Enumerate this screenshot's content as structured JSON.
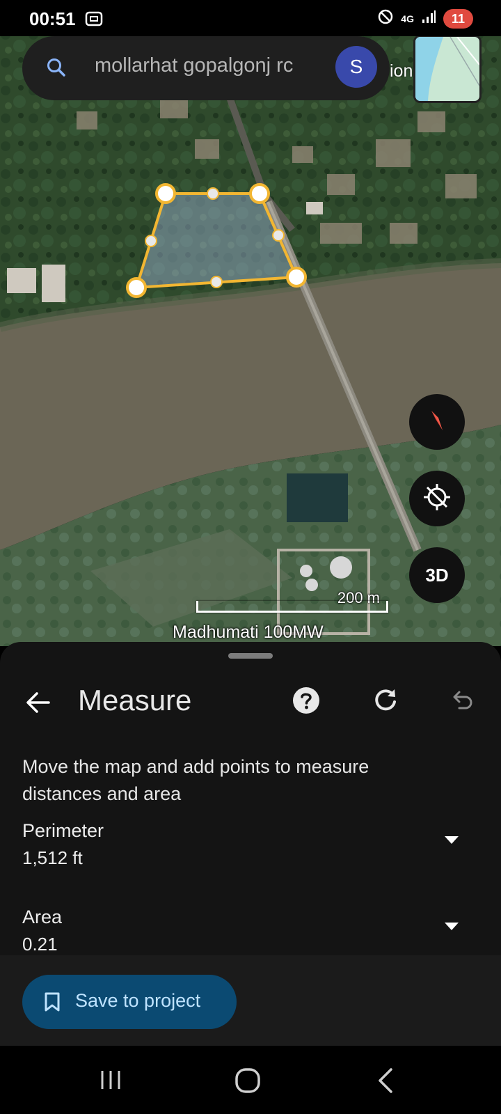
{
  "status_bar": {
    "time": "00:51",
    "network": "4G",
    "battery": "11"
  },
  "search": {
    "placeholder": "mollarhat gopalgonj rc",
    "avatar_letter": "S"
  },
  "map": {
    "scale_label": "200 m",
    "place_label": "Madhumati 100MW",
    "partial_label": "ion",
    "button_3d": "3D"
  },
  "measure_sheet": {
    "title": "Measure",
    "instructions": "Move the map and add points to measure distances and area",
    "perimeter_label": "Perimeter",
    "perimeter_value": "1,512 ft",
    "area_label": "Area",
    "area_value": "0.21"
  },
  "footer": {
    "save_label": "Save to project"
  },
  "colors": {
    "polygon_stroke": "#f2b632",
    "save_button_bg": "#0b4a72",
    "avatar_bg": "#3949ab",
    "battery_bg": "#e04a3f"
  }
}
